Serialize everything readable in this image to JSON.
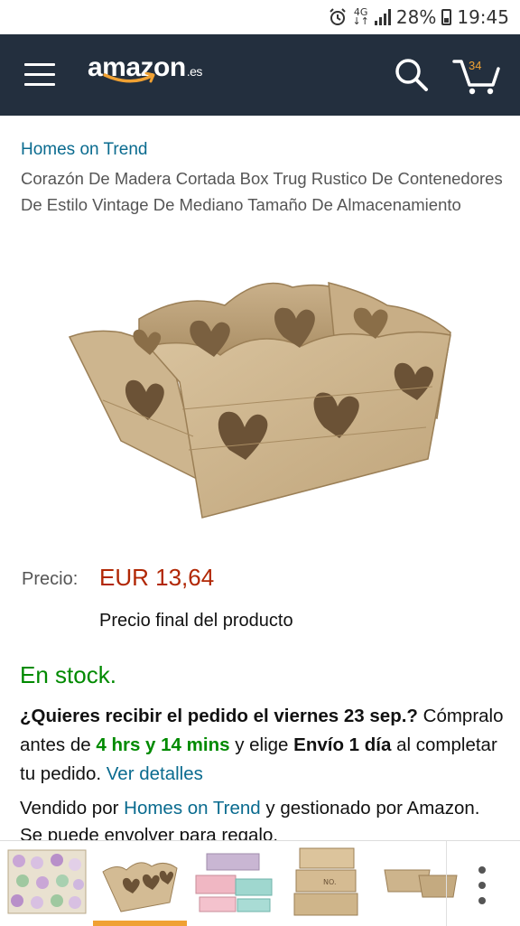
{
  "status_bar": {
    "network_top": "4G",
    "network_bottom": "↓↑",
    "battery": "28%",
    "time": "19:45"
  },
  "header": {
    "logo_text": "amazon",
    "logo_suffix": ".es",
    "cart_count": "34"
  },
  "product": {
    "brand": "Homes on Trend",
    "title": "Corazón De Madera Cortada Box Trug Rustico De Contenedores De Estilo Vintage De Mediano Tamaño De Almacenamiento"
  },
  "pricing": {
    "label": "Precio:",
    "value": "EUR 13,64",
    "note": "Precio final del producto"
  },
  "availability": {
    "stock": "En stock.",
    "question": "¿Quieres recibir el pedido el viernes 23 sep.?",
    "buy_before": "Cómpralo antes de",
    "time_left": "4 hrs y 14 mins",
    "and_choose": "y elige",
    "shipping": "Envío 1 día",
    "complete": "al completar tu pedido.",
    "details_link": "Ver detalles"
  },
  "seller": {
    "sold_by": "Vendido por",
    "seller_name": "Homes on Trend",
    "managed": "y gestionado por Amazon. Se puede envolver para regalo."
  },
  "thumbnails": {
    "selected_index": 1,
    "count": 5
  },
  "colors": {
    "header_bg": "#232f3e",
    "accent_orange": "#f0a133",
    "link_blue": "#0a6b8f",
    "price_red": "#b12704",
    "stock_green": "#008a00"
  }
}
